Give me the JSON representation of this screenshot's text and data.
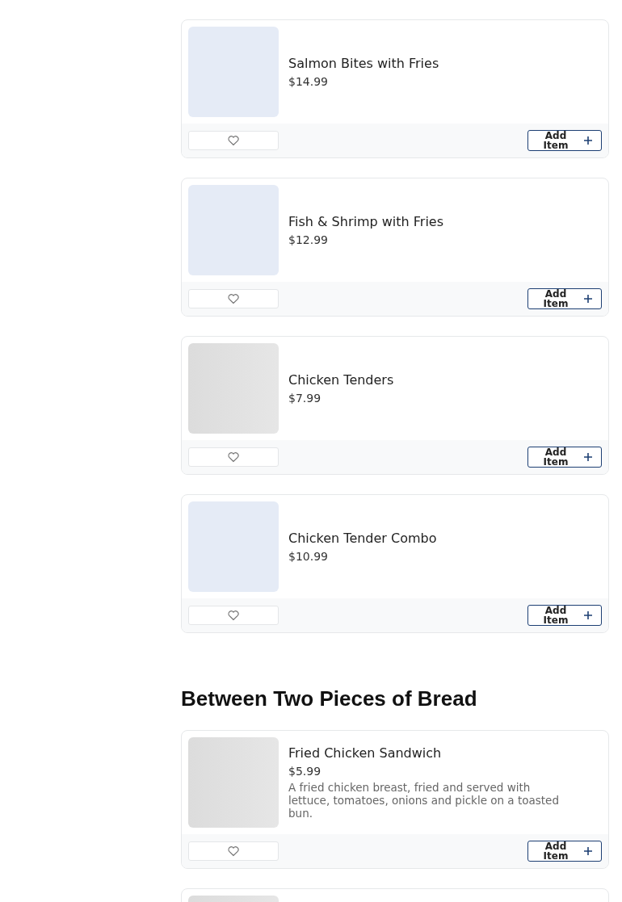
{
  "sections": [
    {
      "items": [
        {
          "kind": "placeholder",
          "name": "Salmon Bites with Fries",
          "price": "$14.99",
          "favorite": false,
          "button": "Add Item"
        },
        {
          "kind": "placeholder",
          "name": "Fish & Shrimp with Fries",
          "price": "$12.99",
          "favorite": false,
          "button": "Add Item"
        },
        {
          "kind": "loading",
          "name": "Chicken Tenders",
          "price": "$7.99",
          "favorite": false,
          "button": "Add Item"
        },
        {
          "kind": "placeholder",
          "name": "Chicken Tender Combo",
          "price": "$10.99",
          "favorite": false,
          "button": "Add Item"
        }
      ]
    },
    {
      "title": "Between Two Pieces of Bread",
      "items": [
        {
          "kind": "loading",
          "name": "Fried Chicken Sandwich",
          "price": "$5.99",
          "description": "A fried chicken breast, fried and served with lettuce, tomatoes, onions and pickle on a toasted bun.",
          "favorite": false,
          "button": "Add Item"
        },
        {
          "kind": "loading"
        }
      ]
    }
  ]
}
